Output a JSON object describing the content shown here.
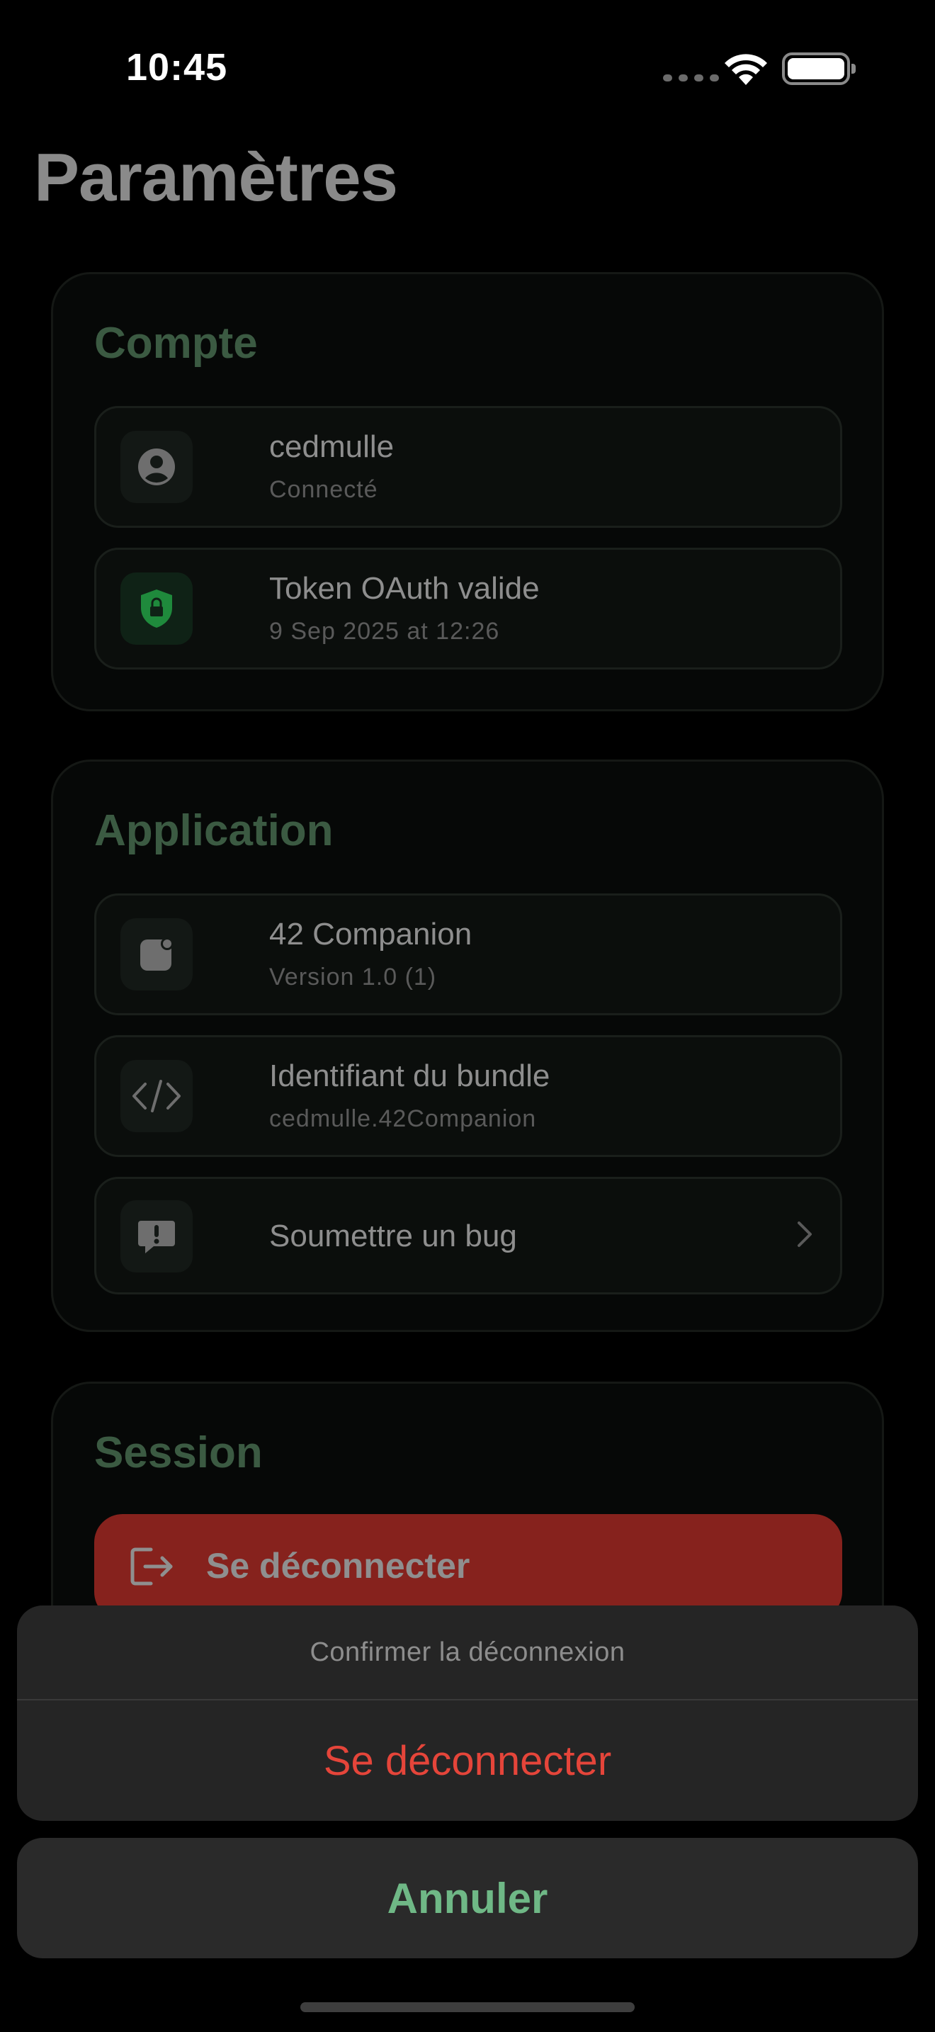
{
  "status_bar": {
    "time": "10:45"
  },
  "page": {
    "title": "Paramètres"
  },
  "sections": {
    "account": {
      "title": "Compte",
      "user": {
        "title": "cedmulle",
        "subtitle": "Connecté",
        "icon": "person-circle-icon"
      },
      "token": {
        "title": "Token OAuth valide",
        "subtitle": "9 Sep 2025 at 12:26",
        "icon": "lock-shield-icon",
        "accent": "#1f8a3c"
      }
    },
    "application": {
      "title": "Application",
      "app": {
        "title": "42 Companion",
        "subtitle": "Version 1.0 (1)",
        "icon": "app-badge-icon"
      },
      "bundle": {
        "title": "Identifiant du bundle",
        "subtitle": "cedmulle.42Companion",
        "icon": "code-icon"
      },
      "bug": {
        "title": "Soumettre un bug",
        "icon": "exclamation-bubble-icon"
      }
    },
    "session": {
      "title": "Session",
      "logout_label": "Se déconnecter",
      "logout_color": "#86221d"
    }
  },
  "action_sheet": {
    "title": "Confirmer la déconnexion",
    "confirm_label": "Se déconnecter",
    "confirm_color": "#e5453a",
    "cancel_label": "Annuler",
    "cancel_color": "#6fb886"
  },
  "colors": {
    "section_title": "#3b5a42",
    "background": "#000000"
  }
}
